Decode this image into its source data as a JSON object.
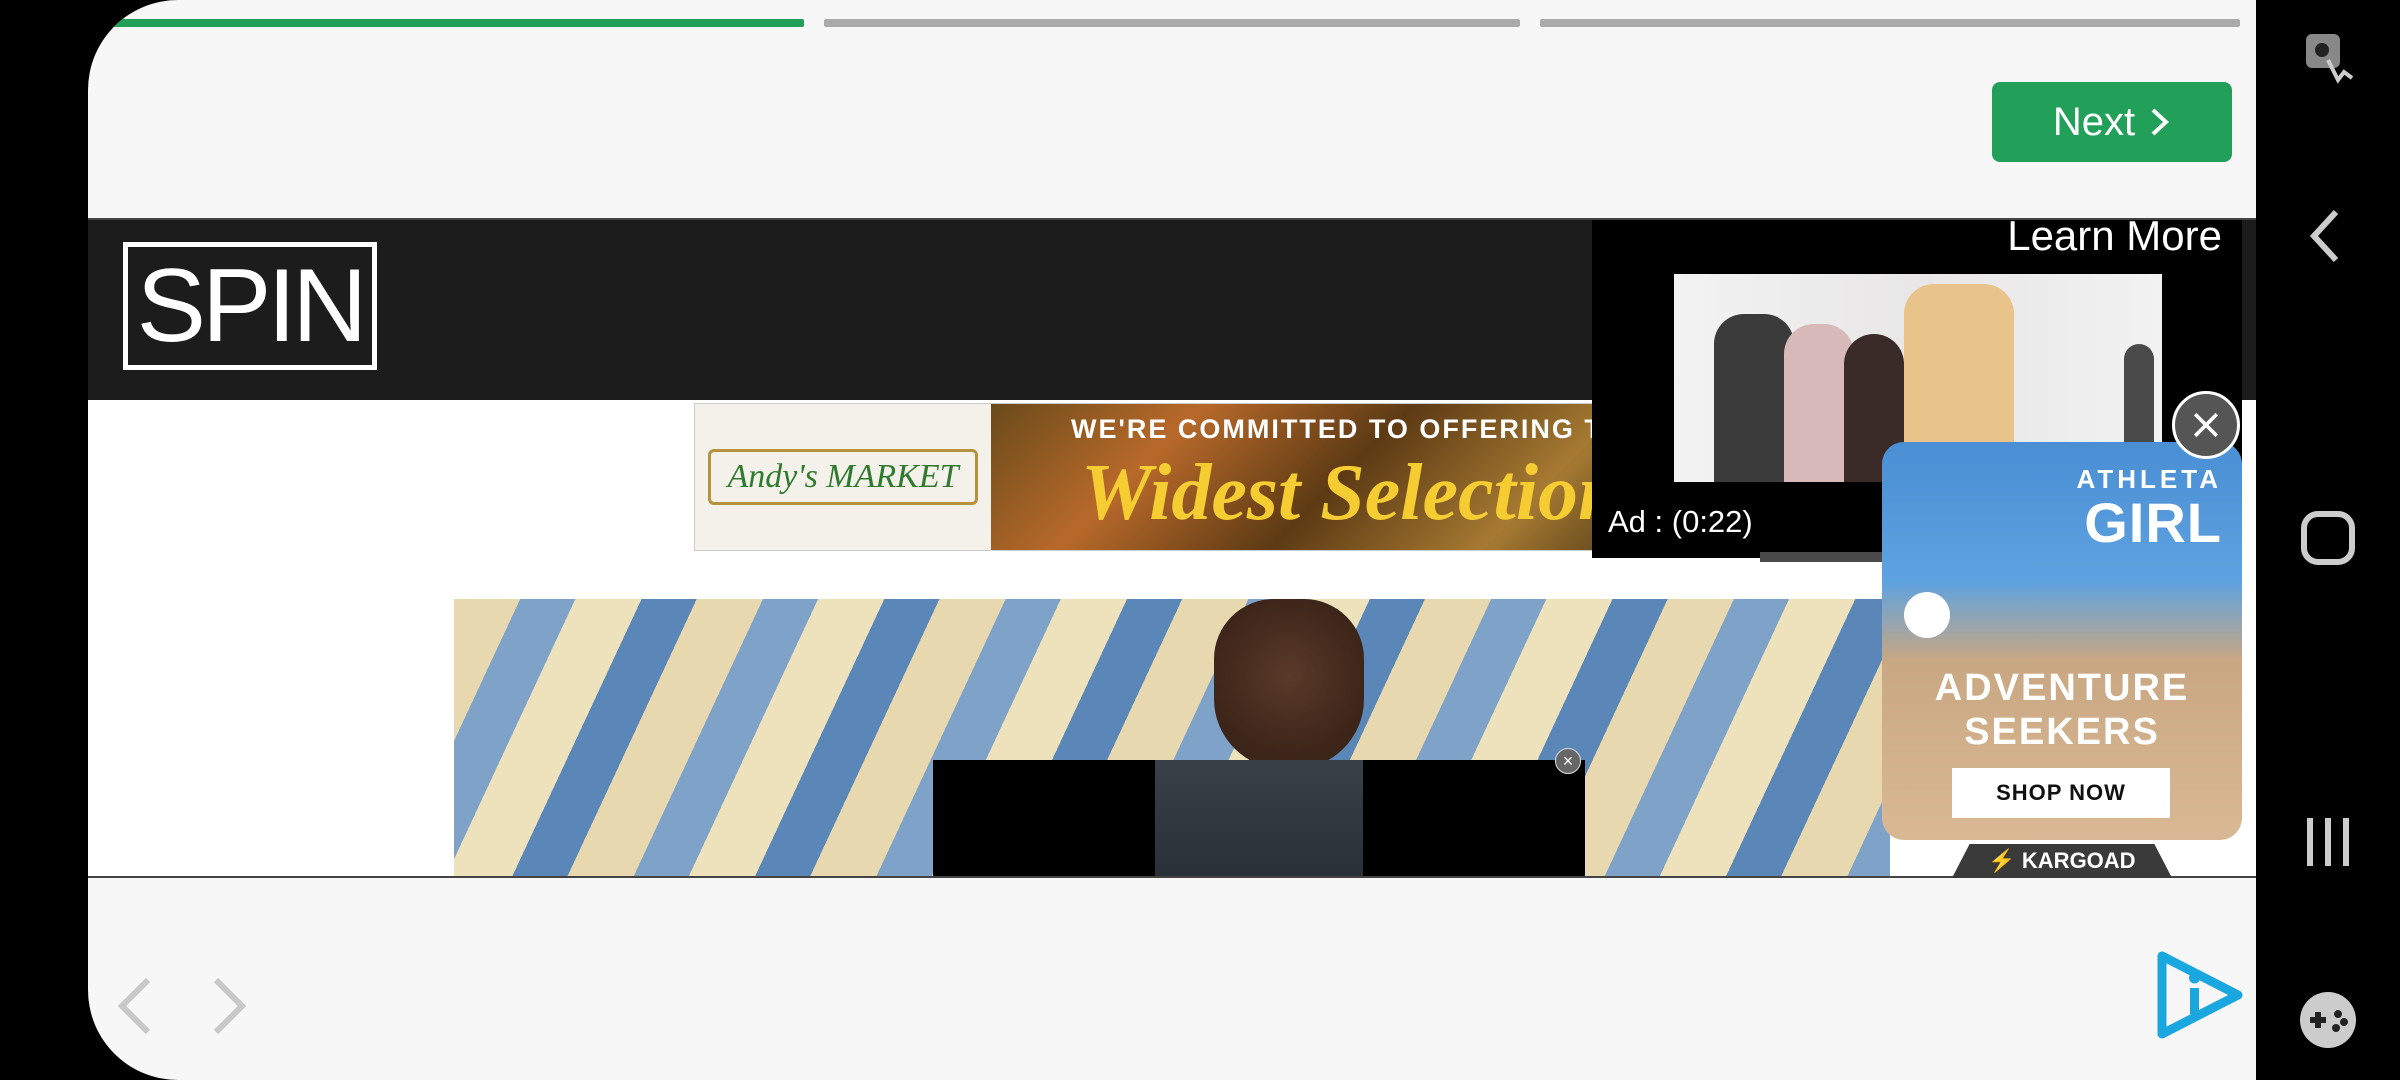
{
  "progress": {
    "segments": [
      {
        "fill": 1.0,
        "color": "#22a05a"
      },
      {
        "fill": 0.0,
        "color": "#aaaaaa"
      },
      {
        "fill": 0.0,
        "color": "#aaaaaa"
      }
    ]
  },
  "toolbar": {
    "next_label": "Next"
  },
  "spin": {
    "logo": "SPIN"
  },
  "banner": {
    "brand": "Andy's MARKET",
    "line1": "WE'RE COMMITTED TO OFFERING THE",
    "line2": "Widest Selection"
  },
  "video_ad": {
    "learn_more": "Learn More",
    "timer": "Ad : (0:22)"
  },
  "kargo_ad": {
    "brand_top": "ATHLETA",
    "brand_bottom": "GIRL",
    "headline_1": "ADVENTURE",
    "headline_2": "SEEKERS",
    "cta": "SHOP NOW",
    "badge": "⚡ KARGOAD"
  },
  "icons": {
    "next": "chevron-right-icon",
    "close": "close-icon",
    "back": "chevron-left-icon",
    "forward": "chevron-right-icon",
    "play": "play-logo-icon",
    "sys_back": "back-icon",
    "sys_home": "home-icon",
    "sys_recents": "recents-icon",
    "sys_game": "game-controller-icon",
    "sys_touch": "touch-icon"
  },
  "colors": {
    "accent": "#22a05a",
    "spin_bar": "#1c1c1c",
    "play_logo": "#1aa7e0"
  }
}
